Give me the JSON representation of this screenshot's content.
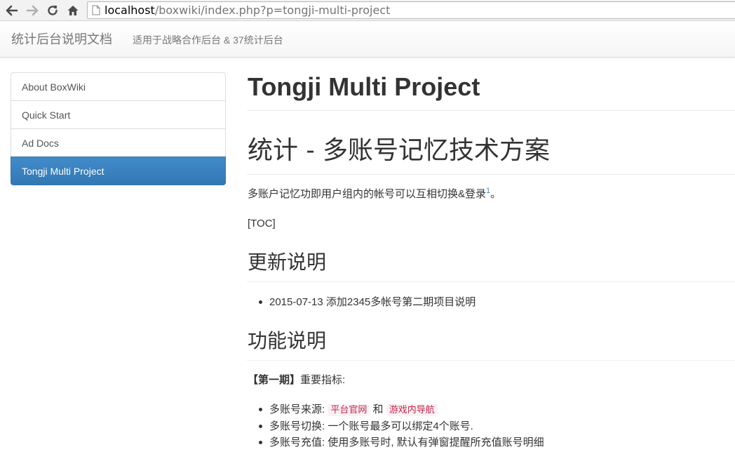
{
  "browser": {
    "address_host": "localhost",
    "address_path": "/boxwiki/index.php?p=tongji-multi-project",
    "icons": {
      "back": "back-arrow-icon",
      "forward": "forward-arrow-icon",
      "reload": "reload-icon",
      "home": "home-icon",
      "page": "page-icon"
    }
  },
  "navbar": {
    "brand": "统计后台说明文档",
    "link": "适用于战略合作后台 & 37统计后台"
  },
  "sidebar": {
    "items": [
      {
        "label": "About BoxWiki"
      },
      {
        "label": "Quick Start"
      },
      {
        "label": "Ad Docs"
      },
      {
        "label": "Tongji Multi Project",
        "active": true
      }
    ],
    "active_color": "#428bca"
  },
  "content": {
    "title": "Tongji Multi Project",
    "h1": "统计 - 多账号记忆技术方案",
    "intro_text": "多账户记忆功即用户组内的帐号可以互相切换&登录",
    "intro_footnote": "1",
    "intro_suffix": "。",
    "toc": "[TOC]",
    "section_update": {
      "heading": "更新说明",
      "items": [
        "2015-07-13 添加2345多帐号第二期项目说明"
      ]
    },
    "section_feature": {
      "heading": "功能说明",
      "phase_label": "【第一期】",
      "phase_rest": "重要指标:",
      "items": {
        "source_prefix": "多账号来源: ",
        "source_code_1": "平台官网",
        "source_and": " 和 ",
        "source_code_2": "游戏内导航",
        "switch": "多账号切换: 一个账号最多可以绑定4个账号.",
        "recharge": "多账号充值: 使用多账号时, 默认有弹窗提醒所充值账号明细"
      }
    }
  }
}
